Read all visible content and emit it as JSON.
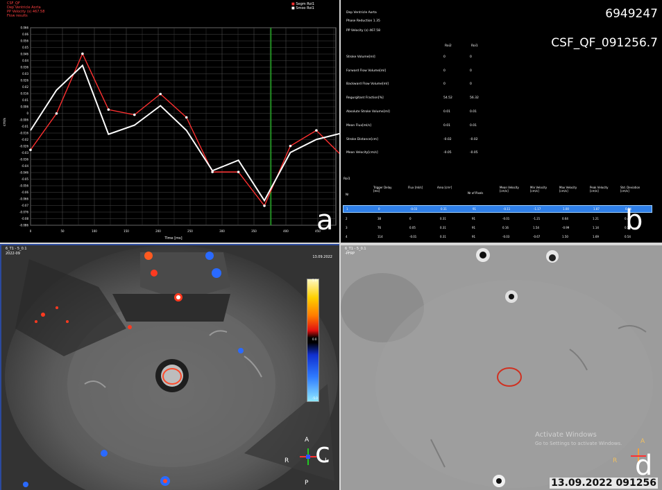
{
  "panel_a": {
    "legend_lines": [
      "CSF_QF",
      "Dep Ventricle Aorta",
      "PP Velocity (s) 467.58",
      "Flow results"
    ],
    "series_names": [
      "Segm Roi1",
      "Smoo Roi1"
    ],
    "y_axis_label": "cm/s",
    "x_axis_label": "Time [ms]",
    "letter": "a",
    "colors": {
      "red": "#ff3030",
      "white": "#ffffff",
      "green": "#22aa22",
      "grid": "#4a4a4a"
    }
  },
  "chart_data": {
    "type": "line",
    "x": [
      0,
      40,
      80,
      120,
      160,
      200,
      240,
      280,
      320,
      360,
      400,
      440,
      480
    ],
    "xticks": [
      "0",
      "50",
      "100",
      "150",
      "200",
      "250",
      "300",
      "350",
      "400",
      "450",
      "500"
    ],
    "yticks": [
      "0.066",
      "0.06",
      "0.056",
      "0.05",
      "0.046",
      "0.04",
      "0.036",
      "0.03",
      "0.026",
      "0.02",
      "0.016",
      "0.01",
      "0.006",
      "0",
      "-0.006",
      "-0.01",
      "-0.016",
      "-0.02",
      "-0.026",
      "-0.03",
      "-0.036",
      "-0.04",
      "-0.046",
      "-0.05",
      "-0.056",
      "-0.06",
      "-0.066",
      "-0.07",
      "-0.076",
      "-0.08",
      "-0.086"
    ],
    "ylim": [
      -0.086,
      0.066
    ],
    "series": [
      {
        "name": "Segm Roi1",
        "color": "#ff3030",
        "values": [
          -0.028,
          0.0,
          0.046,
          0.003,
          -0.001,
          0.015,
          -0.003,
          -0.045,
          -0.045,
          -0.071,
          -0.025,
          -0.013,
          -0.033
        ]
      },
      {
        "name": "Smoo Roi1",
        "color": "#ffffff",
        "values": [
          -0.013,
          0.018,
          0.037,
          -0.016,
          -0.009,
          0.006,
          -0.013,
          -0.044,
          -0.036,
          -0.067,
          -0.03,
          -0.02,
          -0.015
        ]
      }
    ],
    "marker_x": 370,
    "xlim": [
      0,
      470
    ]
  },
  "panel_b": {
    "patient_id": "6949247",
    "series_id": "CSF_QF_091256.7",
    "header_lines": [
      "Dep Ventricle Aorta",
      "Phase Reduction 1.35",
      "PP Velocity (s) 467.58"
    ],
    "column_heads": [
      "Roi2",
      "Roi1"
    ],
    "params": [
      {
        "label": "Stroke Volume[ml]",
        "v1": "0",
        "v2": "0"
      },
      {
        "label": "Forward Flow Volume[ml]",
        "v1": "0",
        "v2": "0"
      },
      {
        "label": "Backward Flow Volume[ml]",
        "v1": "0",
        "v2": "0"
      },
      {
        "label": "Regurgitant Fraction[%]",
        "v1": "54.52",
        "v2": "56.32"
      },
      {
        "label": "Absolute Stroke Volume[ml]",
        "v1": "0.01",
        "v2": "0.01"
      },
      {
        "label": "Mean Flux[ml/s]",
        "v1": "0.01",
        "v2": "0.01"
      },
      {
        "label": "Stroke Distance[cm]",
        "v1": "-0.02",
        "v2": "-0.02"
      },
      {
        "label": "Mean Velocity[cm/s]",
        "v1": "-0.05",
        "v2": "-0.05"
      }
    ],
    "table_title": "Roi1",
    "table_headers": [
      "Nr",
      "Trigger Delay [ms]",
      "Flux [ml/s]",
      "Area [cm²]",
      "Nr of Pixels",
      "Mean Velocity [cm/s]",
      "Min Velocity [cm/s]",
      "Max Velocity [cm/s]",
      "Peak Velocity [cm/s]",
      "Std. Deviation [cm/s]"
    ],
    "table_rows": [
      [
        "1",
        "0",
        "-0.03",
        "0.31",
        "91",
        "-0.11",
        "-1.17",
        "1.00",
        "1.87",
        "0.54"
      ],
      [
        "2",
        "38",
        "0",
        "0.31",
        "91",
        "-0.01",
        "-1.21",
        "0.64",
        "1.21",
        "0.49"
      ],
      [
        "3",
        "76",
        "0.05",
        "0.31",
        "91",
        "0.16",
        "1.54",
        "-0.99",
        "1.14",
        "0.56"
      ],
      [
        "4",
        "114",
        "-0.01",
        "0.31",
        "91",
        "-0.03",
        "-0.67",
        "1.50",
        "1.69",
        "0.54"
      ]
    ],
    "letter": "b"
  },
  "panel_c": {
    "info_lines": [
      "6_T1 - 5_0.1",
      "2022-09"
    ],
    "date": "13.09.2022",
    "colorbar_labels": [
      "5.0",
      "0.0",
      "-5.0"
    ],
    "orientation": {
      "top": "A",
      "left": "R",
      "right": "L",
      "bottom": "P"
    },
    "letter": "c"
  },
  "panel_d": {
    "info_lines": [
      "6_T1 - 5_0.1",
      "-PFRP"
    ],
    "orientation": {
      "top": "A",
      "left": "R"
    },
    "watermark": [
      "Activate Windows",
      "Go to Settings to activate Windows."
    ],
    "date": "13.09.2022 091256",
    "letter": "d"
  }
}
